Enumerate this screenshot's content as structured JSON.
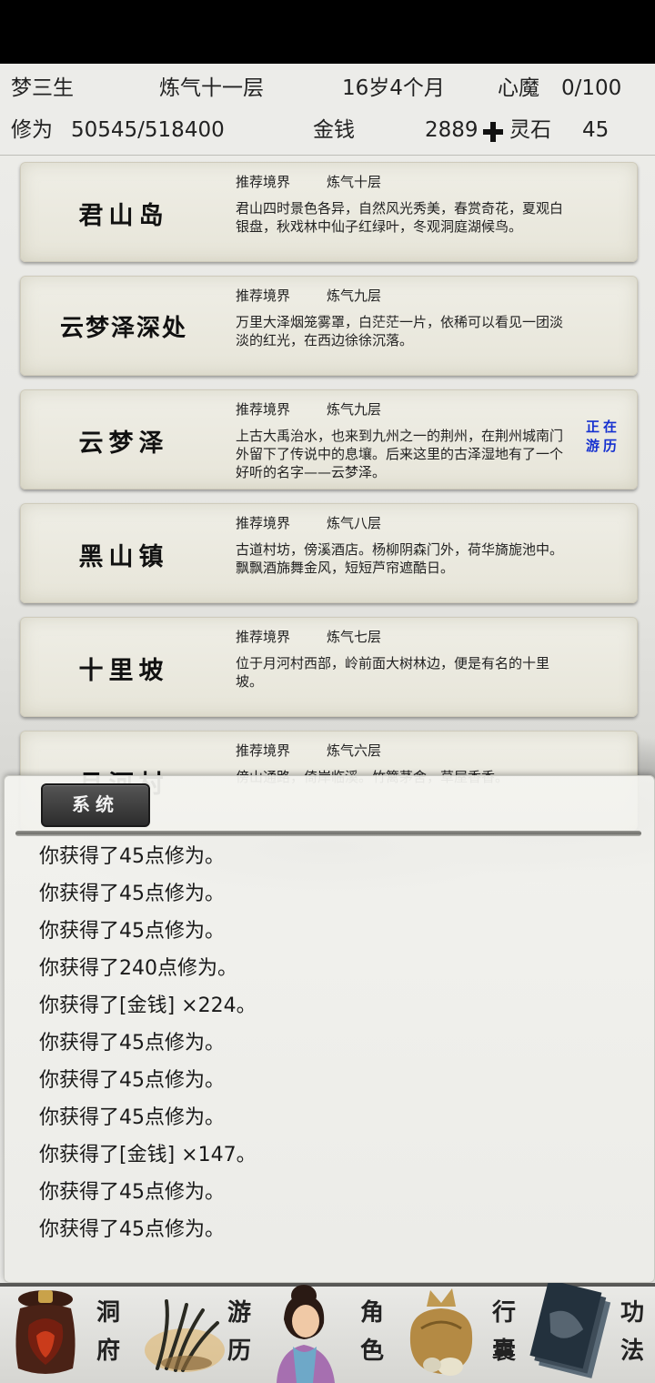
{
  "header": {
    "name": "梦三生",
    "realm": "炼气十一层",
    "age": "16岁4个月",
    "inner_demon_label": "心魔",
    "inner_demon_value": "0/100",
    "cultivation_label": "修为",
    "cultivation_value": "50545/518400",
    "money_label": "金钱",
    "money_value": "2889",
    "spirit_stone_label": "灵石",
    "spirit_stone_value": "45"
  },
  "locations": [
    {
      "name": "君山岛",
      "rec_label": "推荐境界",
      "rec_realm": "炼气十层",
      "desc": "君山四时景色各异，自然风光秀美，春赏奇花，夏观白银盘，秋戏林中仙子红绿叶，冬观洞庭湖候鸟。",
      "badge": ""
    },
    {
      "name": "云梦泽深处",
      "rec_label": "推荐境界",
      "rec_realm": "炼气九层",
      "desc": "万里大泽烟笼雾罩，白茫茫一片，依稀可以看见一团淡淡的红光，在西边徐徐沉落。",
      "badge": ""
    },
    {
      "name": "云梦泽",
      "rec_label": "推荐境界",
      "rec_realm": "炼气九层",
      "desc": "上古大禹治水，也来到九州之一的荆州，在荆州城南门外留下了传说中的息壤。后来这里的古泽湿地有了一个好听的名字——云梦泽。",
      "badge": "正在游历"
    },
    {
      "name": "黑山镇",
      "rec_label": "推荐境界",
      "rec_realm": "炼气八层",
      "desc": "古道村坊，傍溪酒店。杨柳阴森门外，荷华旖旎池中。飘飘酒旆舞金风，短短芦帘遮酷日。",
      "badge": ""
    },
    {
      "name": "十里坡",
      "rec_label": "推荐境界",
      "rec_realm": "炼气七层",
      "desc": "位于月河村西部，岭前面大树林边，便是有名的十里坡。",
      "badge": ""
    },
    {
      "name": "月河村",
      "rec_label": "推荐境界",
      "rec_realm": "炼气六层",
      "desc": "傍山通路，倚岸临溪。竹篱茅舍，草屋香香。",
      "badge": ""
    }
  ],
  "log": {
    "tab_label": "系统",
    "lines": [
      "你获得了45点修为。",
      "你获得了45点修为。",
      "你获得了45点修为。",
      "你获得了240点修为。",
      "你获得了[金钱] ×224。",
      "你获得了45点修为。",
      "你获得了45点修为。",
      "你获得了45点修为。",
      "你获得了[金钱] ×147。",
      "你获得了45点修为。",
      "你获得了45点修为。"
    ]
  },
  "nav": [
    {
      "label": "洞府",
      "icon": "cave-bag-icon"
    },
    {
      "label": "游历",
      "icon": "travel-icon"
    },
    {
      "label": "角色",
      "icon": "character-portrait-icon"
    },
    {
      "label": "行囊",
      "icon": "bag-icon"
    },
    {
      "label": "功法",
      "icon": "manual-book-icon"
    }
  ]
}
